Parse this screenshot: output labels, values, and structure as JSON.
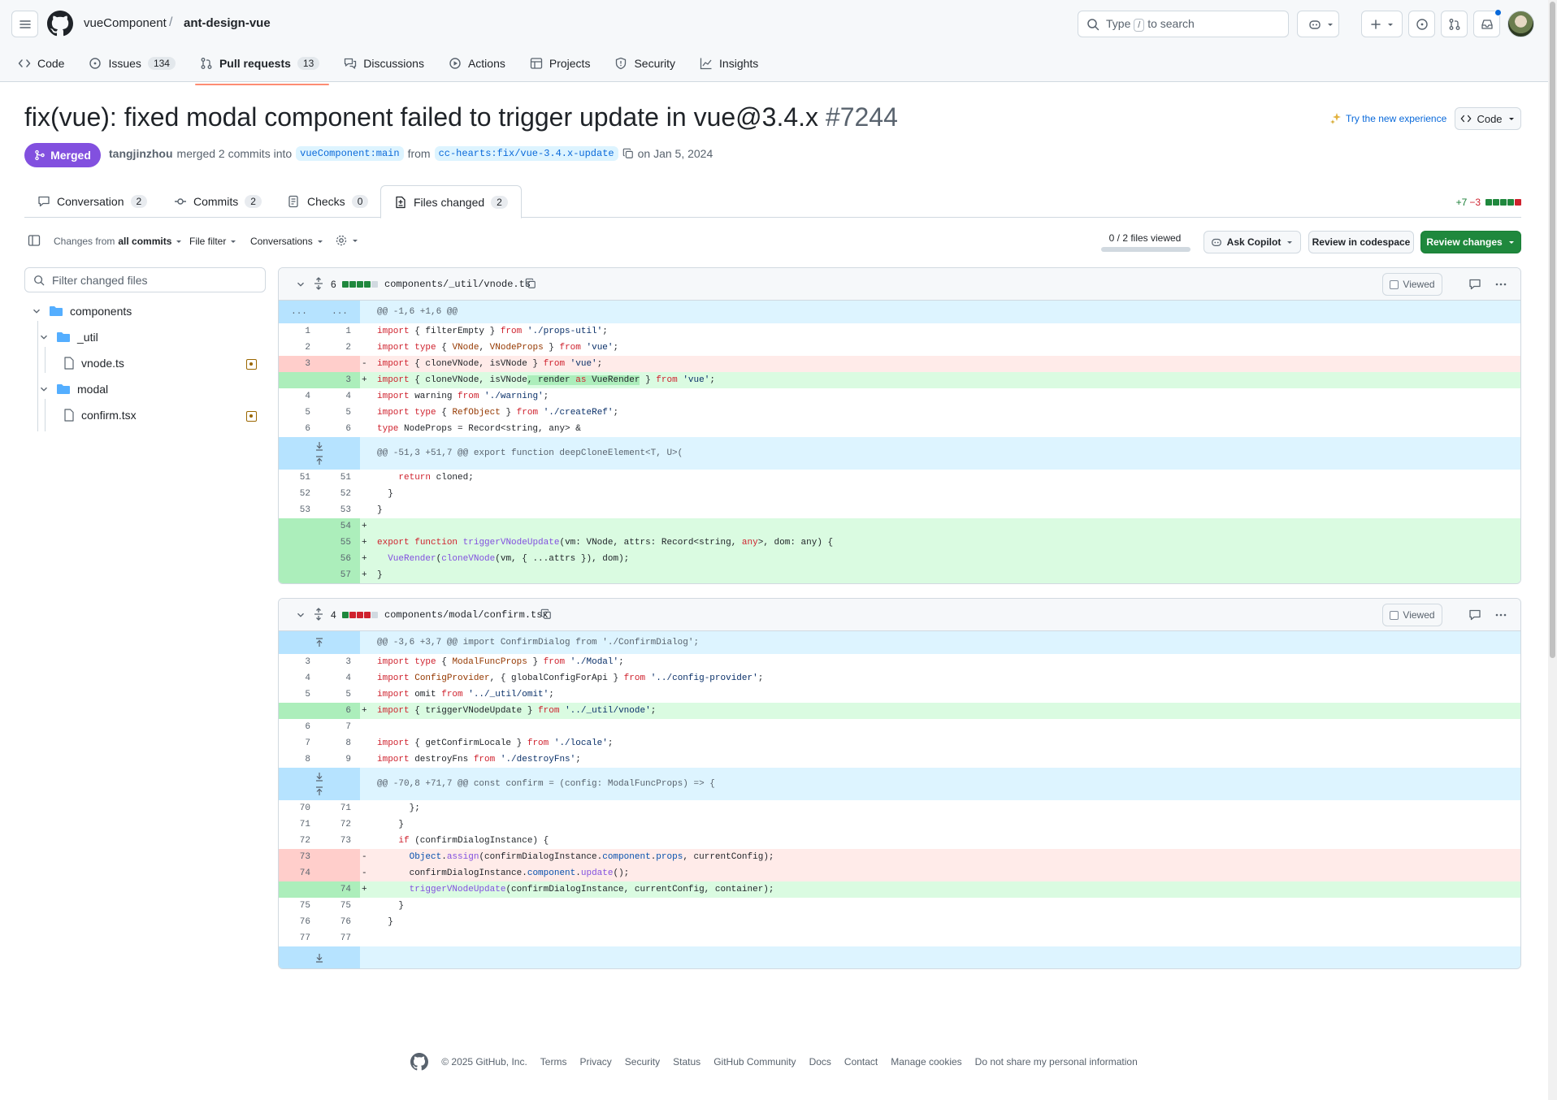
{
  "header": {
    "owner": "vueComponent",
    "separator": "/",
    "repo": "ant-design-vue",
    "search_placeholder_prefix": "Type",
    "search_key": "/",
    "search_placeholder_suffix": "to search"
  },
  "repo_tabs": [
    {
      "label": "Code",
      "icon": "code-icon"
    },
    {
      "label": "Issues",
      "count": "134",
      "icon": "issue-icon"
    },
    {
      "label": "Pull requests",
      "count": "13",
      "icon": "pull-request-icon",
      "selected": true
    },
    {
      "label": "Discussions",
      "icon": "discussion-icon"
    },
    {
      "label": "Actions",
      "icon": "play-icon"
    },
    {
      "label": "Projects",
      "icon": "table-icon"
    },
    {
      "label": "Security",
      "icon": "shield-icon"
    },
    {
      "label": "Insights",
      "icon": "graph-icon"
    }
  ],
  "pr": {
    "title": "fix(vue): fixed modal component failed to trigger update in vue@3.4.x",
    "number": "#7244",
    "state": "Merged",
    "author": "tangjinzhou",
    "merged_text": "merged 2 commits into",
    "base_branch": "vueComponent:main",
    "from_text": "from",
    "head_branch": "cc-hearts:fix/vue-3.4.x-update",
    "date_text": "on Jan 5, 2024",
    "try_new": "Try the new experience",
    "code_button": "Code"
  },
  "pr_tabs": [
    {
      "label": "Conversation",
      "count": "2",
      "icon": "comment-icon"
    },
    {
      "label": "Commits",
      "count": "2",
      "icon": "commit-icon"
    },
    {
      "label": "Checks",
      "count": "0",
      "icon": "checklist-icon"
    },
    {
      "label": "Files changed",
      "count": "2",
      "icon": "file-diff-icon",
      "selected": true
    }
  ],
  "diffstat": {
    "additions": "+7",
    "deletions": "−3"
  },
  "toolbar": {
    "changes_from_prefix": "Changes from",
    "changes_from_value": "all commits",
    "file_filter": "File filter",
    "conversations": "Conversations",
    "files_viewed": "0 / 2 files viewed",
    "ask_copilot": "Ask Copilot",
    "review_codespace": "Review in codespace",
    "review_changes": "Review changes"
  },
  "file_tree": {
    "filter_placeholder": "Filter changed files",
    "nodes": [
      {
        "label": "components",
        "type": "folder"
      },
      {
        "label": "_util",
        "type": "folder"
      },
      {
        "label": "vnode.ts",
        "type": "file"
      },
      {
        "label": "modal",
        "type": "folder"
      },
      {
        "label": "confirm.tsx",
        "type": "file"
      }
    ]
  },
  "files": [
    {
      "changes": "6",
      "path": "components/_util/vnode.ts",
      "viewed_label": "Viewed",
      "blocks": [
        "add",
        "add",
        "add",
        "add",
        "neutral"
      ],
      "hunk1": "@@ -1,6 +1,6 @@",
      "hunk2": "@@ -51,3 +51,7 @@ export function deepCloneElement<T, U>(",
      "gutter_dots": "..."
    },
    {
      "changes": "4",
      "path": "components/modal/confirm.tsx",
      "viewed_label": "Viewed",
      "blocks": [
        "add",
        "del",
        "del",
        "del",
        "neutral"
      ],
      "hunk1": "@@ -3,6 +3,7 @@ import ConfirmDialog from './ConfirmDialog';",
      "hunk2": "@@ -70,8 +71,7 @@ const confirm = (config: ModalFuncProps) => {"
    }
  ],
  "footer": {
    "copyright": "© 2025 GitHub, Inc.",
    "links": [
      "Terms",
      "Privacy",
      "Security",
      "Status",
      "GitHub Community",
      "Docs",
      "Contact",
      "Manage cookies",
      "Do not share my personal information"
    ]
  },
  "colors": {
    "accent": "#0969da",
    "merged": "#8250df",
    "add": "#1f883d",
    "del": "#cf222e"
  }
}
